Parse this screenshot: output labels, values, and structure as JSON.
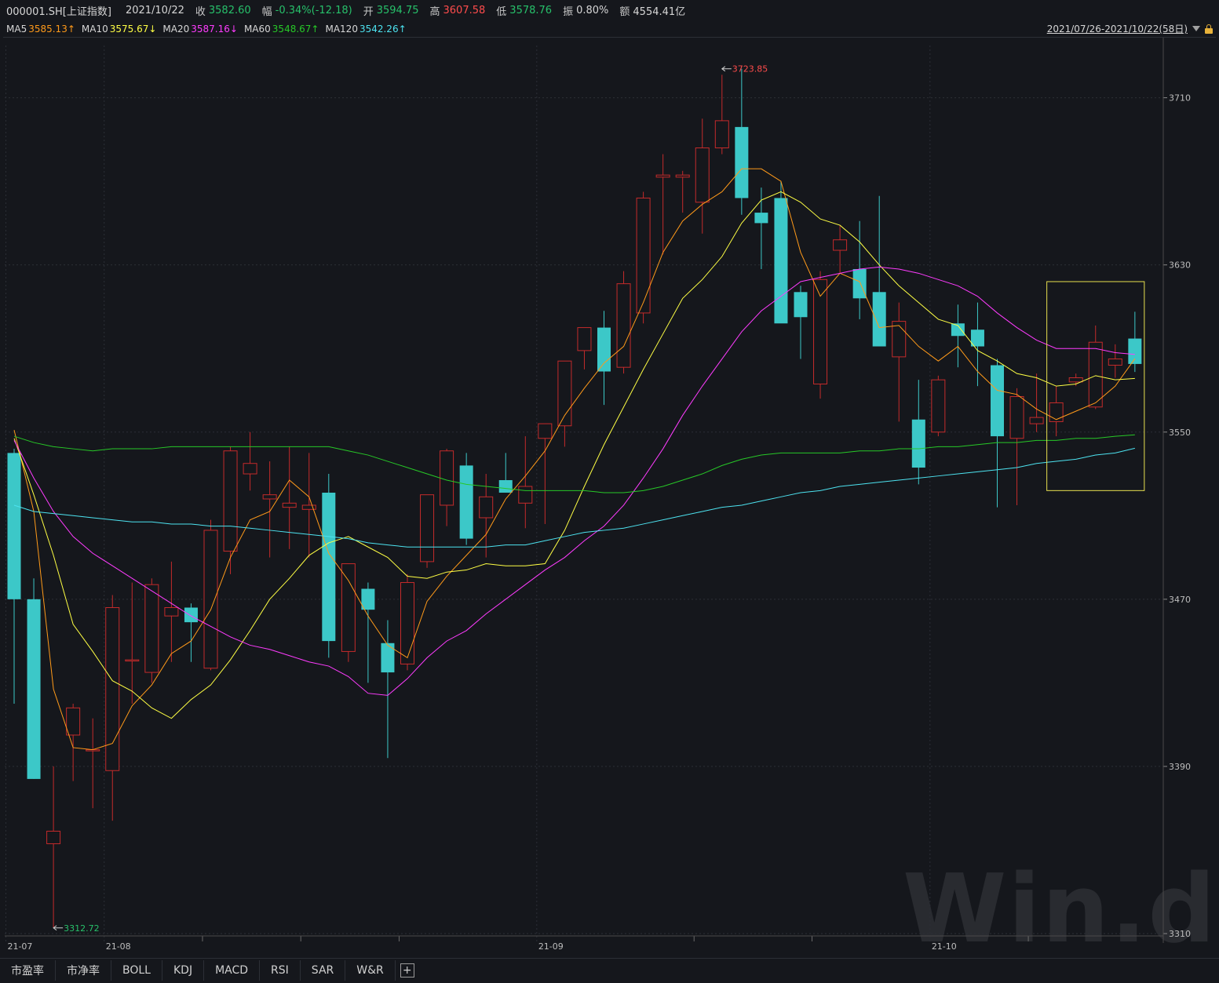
{
  "header": {
    "code": "000001.SH[上证指数]",
    "date": "2021/10/22",
    "close_label": "收",
    "close": "3582.60",
    "change_label": "幅",
    "change": "-0.34%(-12.18)",
    "open_label": "开",
    "open": "3594.75",
    "high_label": "高",
    "high": "3607.58",
    "low_label": "低",
    "low": "3578.76",
    "amp_label": "振",
    "amp": "0.80%",
    "amount_label": "额",
    "amount": "4554.41亿"
  },
  "ma_row": [
    {
      "label": "MA5",
      "value": "3585.13↑",
      "color": "#ff9a1a"
    },
    {
      "label": "MA10",
      "value": "3575.67↓",
      "color": "#ffff44"
    },
    {
      "label": "MA20",
      "value": "3587.16↓",
      "color": "#ff3cff"
    },
    {
      "label": "MA60",
      "value": "3548.67↑",
      "color": "#27c827"
    },
    {
      "label": "MA120",
      "value": "3542.26↑",
      "color": "#4de3f0"
    }
  ],
  "range": "2021/07/26-2021/10/22(58日)",
  "watermark": "Win.d",
  "tabs": [
    "市盈率",
    "市净率",
    "BOLL",
    "KDJ",
    "MACD",
    "RSI",
    "SAR",
    "W&R"
  ],
  "colors": {
    "up": "#c42b2b",
    "down": "#3cc8c8",
    "background": "#15171c",
    "grid": "#2c2f36",
    "highlight_box": "#e8e050"
  },
  "chart_data": {
    "type": "candlestick",
    "title": "000001.SH[上证指数]",
    "ylim": [
      3310,
      3735
    ],
    "yticks": [
      3310,
      3390,
      3470,
      3550,
      3630,
      3710
    ],
    "xtick_labels": [
      {
        "index": 0,
        "label": "21-07"
      },
      {
        "index": 5,
        "label": "21-08"
      },
      {
        "index": 27,
        "label": "21-09"
      },
      {
        "index": 47,
        "label": "21-10"
      }
    ],
    "annotations": [
      {
        "index": 36,
        "value": 3723.85,
        "text": "3723.85",
        "color": "#ff4c4c"
      },
      {
        "index": 2,
        "value": 3312.72,
        "text": "3312.72",
        "color": "#27c06a"
      }
    ],
    "highlight_range": {
      "from_index": 53,
      "to_index": 57,
      "low": 3522,
      "high": 3622
    },
    "candles": [
      {
        "o": 3540,
        "h": 3542,
        "l": 3420,
        "c": 3470
      },
      {
        "o": 3470,
        "h": 3480,
        "l": 3384,
        "c": 3384
      },
      {
        "o": 3353,
        "h": 3390,
        "l": 3313,
        "c": 3359
      },
      {
        "o": 3405,
        "h": 3420,
        "l": 3383,
        "c": 3418
      },
      {
        "o": 3398,
        "h": 3413,
        "l": 3370,
        "c": 3398
      },
      {
        "o": 3388,
        "h": 3472,
        "l": 3364,
        "c": 3466
      },
      {
        "o": 3441,
        "h": 3478,
        "l": 3420,
        "c": 3441
      },
      {
        "o": 3435,
        "h": 3480,
        "l": 3430,
        "c": 3477
      },
      {
        "o": 3462,
        "h": 3488,
        "l": 3440,
        "c": 3466
      },
      {
        "o": 3466,
        "h": 3468,
        "l": 3440,
        "c": 3459
      },
      {
        "o": 3437,
        "h": 3508,
        "l": 3436,
        "c": 3503
      },
      {
        "o": 3493,
        "h": 3543,
        "l": 3482,
        "c": 3541
      },
      {
        "o": 3530,
        "h": 3550,
        "l": 3522,
        "c": 3535
      },
      {
        "o": 3518,
        "h": 3536,
        "l": 3490,
        "c": 3520
      },
      {
        "o": 3514,
        "h": 3543,
        "l": 3494,
        "c": 3516
      },
      {
        "o": 3513,
        "h": 3540,
        "l": 3490,
        "c": 3515
      },
      {
        "o": 3521,
        "h": 3530,
        "l": 3442,
        "c": 3450
      },
      {
        "o": 3445,
        "h": 3484,
        "l": 3440,
        "c": 3487
      },
      {
        "o": 3475,
        "h": 3478,
        "l": 3430,
        "c": 3465
      },
      {
        "o": 3449,
        "h": 3460,
        "l": 3394,
        "c": 3435
      },
      {
        "o": 3439,
        "h": 3482,
        "l": 3436,
        "c": 3478
      },
      {
        "o": 3488,
        "h": 3520,
        "l": 3485,
        "c": 3520
      },
      {
        "o": 3515,
        "h": 3542,
        "l": 3505,
        "c": 3541
      },
      {
        "o": 3534,
        "h": 3540,
        "l": 3496,
        "c": 3499
      },
      {
        "o": 3509,
        "h": 3530,
        "l": 3490,
        "c": 3519
      },
      {
        "o": 3527,
        "h": 3540,
        "l": 3522,
        "c": 3521
      },
      {
        "o": 3516,
        "h": 3548,
        "l": 3504,
        "c": 3524
      },
      {
        "o": 3547,
        "h": 3554,
        "l": 3506,
        "c": 3554
      },
      {
        "o": 3553,
        "h": 3574,
        "l": 3543,
        "c": 3584
      },
      {
        "o": 3589,
        "h": 3592,
        "l": 3580,
        "c": 3600
      },
      {
        "o": 3600,
        "h": 3608,
        "l": 3563,
        "c": 3579
      },
      {
        "o": 3581,
        "h": 3627,
        "l": 3578,
        "c": 3621
      },
      {
        "o": 3607,
        "h": 3665,
        "l": 3602,
        "c": 3662
      },
      {
        "o": 3672,
        "h": 3683,
        "l": 3635,
        "c": 3673
      },
      {
        "o": 3672,
        "h": 3675,
        "l": 3655,
        "c": 3673
      },
      {
        "o": 3660,
        "h": 3700,
        "l": 3645,
        "c": 3686
      },
      {
        "o": 3686,
        "h": 3721,
        "l": 3683,
        "c": 3699
      },
      {
        "o": 3696,
        "h": 3723.85,
        "l": 3654,
        "c": 3662
      },
      {
        "o": 3655,
        "h": 3667,
        "l": 3628,
        "c": 3650
      },
      {
        "o": 3662,
        "h": 3670,
        "l": 3610,
        "c": 3602
      },
      {
        "o": 3617,
        "h": 3620,
        "l": 3585,
        "c": 3605
      },
      {
        "o": 3573,
        "h": 3627,
        "l": 3566,
        "c": 3623
      },
      {
        "o": 3637,
        "h": 3649,
        "l": 3626,
        "c": 3642
      },
      {
        "o": 3628,
        "h": 3651,
        "l": 3604,
        "c": 3614
      },
      {
        "o": 3617,
        "h": 3663,
        "l": 3594,
        "c": 3591
      },
      {
        "o": 3586,
        "h": 3612,
        "l": 3555,
        "c": 3603
      },
      {
        "o": 3556,
        "h": 3575,
        "l": 3525,
        "c": 3533
      },
      {
        "o": 3550,
        "h": 3577,
        "l": 3548,
        "c": 3575
      },
      {
        "o": 3602,
        "h": 3611,
        "l": 3581,
        "c": 3596
      },
      {
        "o": 3599,
        "h": 3612,
        "l": 3572,
        "c": 3591
      },
      {
        "o": 3582,
        "h": 3585,
        "l": 3514,
        "c": 3548
      },
      {
        "o": 3547,
        "h": 3571,
        "l": 3515,
        "c": 3567
      },
      {
        "o": 3554,
        "h": 3578,
        "l": 3550,
        "c": 3557
      },
      {
        "o": 3555,
        "h": 3572,
        "l": 3548,
        "c": 3564
      },
      {
        "o": 3574,
        "h": 3578,
        "l": 3572,
        "c": 3576
      },
      {
        "o": 3562,
        "h": 3601,
        "l": 3561,
        "c": 3593
      },
      {
        "o": 3582,
        "h": 3592,
        "l": 3576,
        "c": 3585
      },
      {
        "o": 3594.75,
        "h": 3607.58,
        "l": 3578.76,
        "c": 3582.6
      }
    ],
    "series": [
      {
        "name": "MA5",
        "color": "#ff9a1a",
        "values": [
          3551,
          3512,
          3427,
          3399,
          3398,
          3401,
          3419,
          3429,
          3444,
          3450,
          3465,
          3490,
          3508,
          3512,
          3527,
          3519,
          3492,
          3479,
          3462,
          3448,
          3442,
          3469,
          3481,
          3491,
          3501,
          3518,
          3529,
          3541,
          3558,
          3571,
          3583,
          3591,
          3612,
          3636,
          3651,
          3659,
          3665,
          3676,
          3676,
          3670,
          3636,
          3615,
          3626,
          3622,
          3600,
          3601,
          3591,
          3584,
          3591,
          3579,
          3570,
          3568,
          3561,
          3556,
          3560,
          3564,
          3572,
          3585.13
        ]
      },
      {
        "name": "MA10",
        "color": "#ffff44",
        "values": [
          3547,
          3520,
          3491,
          3458,
          3445,
          3431,
          3426,
          3418,
          3413,
          3422,
          3429,
          3441,
          3455,
          3470,
          3480,
          3491,
          3497,
          3500,
          3495,
          3490,
          3481,
          3480,
          3483,
          3484,
          3487,
          3486,
          3486,
          3487,
          3503,
          3524,
          3544,
          3562,
          3580,
          3597,
          3614,
          3623,
          3634,
          3650,
          3661,
          3665,
          3660,
          3652,
          3649,
          3641,
          3630,
          3620,
          3612,
          3604,
          3601,
          3589,
          3584,
          3578,
          3576,
          3572,
          3573,
          3577,
          3575,
          3575.67
        ]
      },
      {
        "name": "MA20",
        "color": "#ff3cff",
        "values": [
          3546,
          3528,
          3512,
          3500,
          3492,
          3486,
          3480,
          3474,
          3468,
          3462,
          3457,
          3452,
          3448,
          3446,
          3443,
          3440,
          3438,
          3433,
          3425,
          3424,
          3432,
          3442,
          3450,
          3455,
          3463,
          3470,
          3477,
          3484,
          3490,
          3498,
          3505,
          3515,
          3528,
          3542,
          3558,
          3572,
          3585,
          3598,
          3608,
          3615,
          3622,
          3624,
          3626,
          3628,
          3629,
          3628,
          3626,
          3623,
          3620,
          3615,
          3607,
          3600,
          3594,
          3590,
          3590,
          3590,
          3588,
          3587.16
        ]
      },
      {
        "name": "MA60",
        "color": "#27c827",
        "values": [
          3548,
          3545,
          3543,
          3542,
          3541,
          3542,
          3542,
          3542,
          3543,
          3543,
          3543,
          3543,
          3543,
          3543,
          3543,
          3543,
          3543,
          3541,
          3539,
          3536,
          3533,
          3530,
          3527,
          3525,
          3524,
          3523,
          3522,
          3522,
          3522,
          3522,
          3521,
          3521,
          3522,
          3524,
          3527,
          3530,
          3534,
          3537,
          3539,
          3540,
          3540,
          3540,
          3540,
          3541,
          3541,
          3542,
          3542,
          3543,
          3543,
          3544,
          3545,
          3545,
          3546,
          3546,
          3547,
          3547,
          3548,
          3548.67
        ]
      },
      {
        "name": "MA120",
        "color": "#4de3f0",
        "values": [
          3515,
          3512,
          3511,
          3510,
          3509,
          3508,
          3507,
          3507,
          3506,
          3506,
          3505,
          3505,
          3504,
          3503,
          3502,
          3501,
          3500,
          3499,
          3497,
          3496,
          3495,
          3495,
          3495,
          3495,
          3495,
          3496,
          3496,
          3498,
          3500,
          3502,
          3503,
          3504,
          3506,
          3508,
          3510,
          3512,
          3514,
          3515,
          3517,
          3519,
          3521,
          3522,
          3524,
          3525,
          3526,
          3527,
          3528,
          3529,
          3530,
          3531,
          3532,
          3533,
          3535,
          3536,
          3537,
          3539,
          3540,
          3542.26
        ]
      }
    ]
  }
}
